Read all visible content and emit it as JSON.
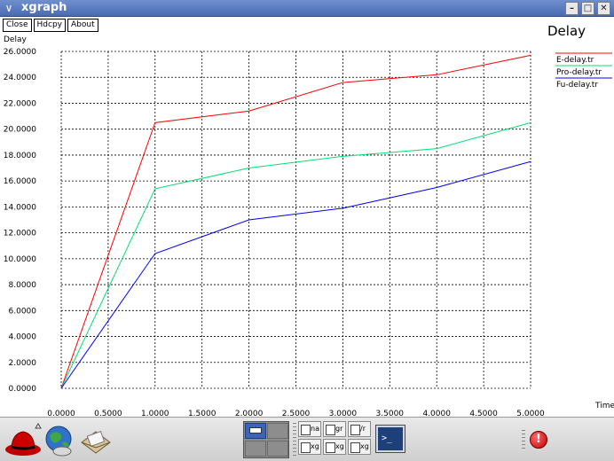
{
  "window": {
    "title": "xgraph",
    "menu_glyph": "∨",
    "minimize_glyph": "–",
    "maximize_glyph": "□",
    "close_glyph": "✕"
  },
  "toolbar": {
    "close_label": "Close",
    "hdcpy_label": "Hdcpy",
    "about_label": "About"
  },
  "chart_data": {
    "type": "line",
    "title": "Delay",
    "xlabel": "Time",
    "ylabel": "Delay",
    "xlim": [
      0,
      5
    ],
    "ylim": [
      0,
      26
    ],
    "grid": true,
    "legend_position": "top-right",
    "x_ticks": [
      "0.0000",
      "0.5000",
      "1.0000",
      "1.5000",
      "2.0000",
      "2.5000",
      "3.0000",
      "3.5000",
      "4.0000",
      "4.5000",
      "5.0000"
    ],
    "y_ticks": [
      "0.0000",
      "2.0000",
      "4.0000",
      "6.0000",
      "8.0000",
      "10.0000",
      "12.0000",
      "14.0000",
      "16.0000",
      "18.0000",
      "20.0000",
      "22.0000",
      "24.0000",
      "26.0000"
    ],
    "series": [
      {
        "name": "E-delay.tr",
        "color": "#ff0000",
        "x": [
          0,
          1,
          2,
          3,
          4,
          5
        ],
        "y": [
          0,
          20.5,
          21.4,
          23.6,
          24.2,
          25.7
        ]
      },
      {
        "name": "Pro-delay.tr",
        "color": "#00e070",
        "x": [
          0,
          1,
          2,
          3,
          4,
          5
        ],
        "y": [
          0,
          15.4,
          17.0,
          17.9,
          18.5,
          20.5
        ]
      },
      {
        "name": "Fu-delay.tr",
        "color": "#0000ff",
        "x": [
          0,
          1,
          2,
          3,
          4,
          5
        ],
        "y": [
          0,
          10.4,
          13.0,
          13.9,
          15.5,
          17.5
        ]
      }
    ]
  },
  "taskbar": {
    "launchers": [
      {
        "name": "redhat-menu-icon"
      },
      {
        "name": "browser-globe-icon"
      },
      {
        "name": "mail-icon"
      }
    ],
    "tasks": [
      "na",
      "gr",
      "/r",
      "xg",
      "xg",
      "xg"
    ],
    "terminal_glyph": ">_",
    "alert_glyph": "!"
  }
}
